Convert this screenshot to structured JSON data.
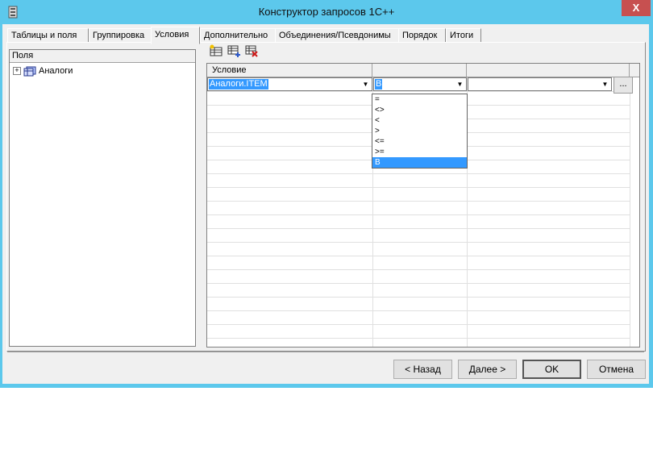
{
  "window": {
    "title": "Конструктор запросов 1С++",
    "close_label": "X"
  },
  "tabs": [
    {
      "label": "Таблицы и поля"
    },
    {
      "label": "Группировка"
    },
    {
      "label": "Условия"
    },
    {
      "label": "Дополнительно"
    },
    {
      "label": "Объединения/Псевдонимы"
    },
    {
      "label": "Порядок"
    },
    {
      "label": "Итоги"
    }
  ],
  "active_tab": "Условия",
  "fields": {
    "header": "Поля",
    "tree": [
      {
        "label": "Аналоги",
        "expander": "+"
      }
    ]
  },
  "toolbar": {
    "icons": [
      "add-row-icon",
      "insert-row-icon",
      "delete-row-icon"
    ]
  },
  "conditions_grid": {
    "columns": [
      "Условие",
      "",
      ""
    ],
    "row": {
      "field_value": "Аналоги.ITEM",
      "operator_value": "В",
      "value_value": "",
      "ellipsis_label": "..."
    }
  },
  "operator_dropdown": {
    "options": [
      "=",
      "<>",
      "<",
      ">",
      "<=",
      ">=",
      "В"
    ],
    "selected_index": 6
  },
  "buttons": {
    "back": "< Назад",
    "next": "Далее >",
    "ok": "OK",
    "cancel": "Отмена"
  },
  "colors": {
    "titlebar": "#5cc8ec",
    "selection": "#3399ff",
    "close": "#c75050"
  }
}
